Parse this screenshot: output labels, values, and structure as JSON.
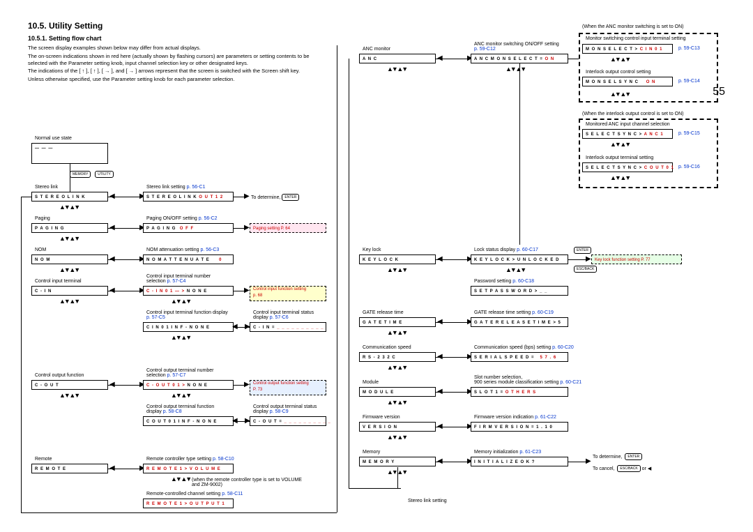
{
  "title": "10.5. Utility Setting",
  "subtitle": "10.5.1. Setting flow chart",
  "para1": "The screen display examples shown below may differ from actual displays.",
  "para2": "The on-screen indications shown in red here (actually shown by flashing cursors) are parameters or setting contents to be selected with the Parameter setting knob, input channel selection key or other designated keys.",
  "para3": "The indications of the [ ↑ ], [ ↑ ], [ → ], and [ → ] arrows represent that the screen is switched with the Screen shift key.",
  "para4": "Unless otherwise specified, use the Parameter setting knob for each parameter selection.",
  "page_num": "55",
  "col1": {
    "normal_use": "Normal use state",
    "normal_box": "— — —",
    "memory_btn": "MEMORY",
    "utility_btn": "UTILITY",
    "stereo_label": "Stereo link",
    "stereo_box": "S T E R E O    L I N K",
    "paging_label": "Paging",
    "paging_box": "P A G I N G",
    "nom_label": "NOM",
    "nom_box": "N O M",
    "cin_label": "Control input terminal",
    "cin_box": "C - I N",
    "cout_label": "Control output function",
    "cout_box": "C - O U T",
    "remote_label": "Remote",
    "remote_box": "R E M O T E"
  },
  "col2": {
    "stereo_set_label": "Stereo link setting",
    "stereo_set_ref": "p. 56-C1",
    "stereo_set_box_a": "S T E R E O    L I N K",
    "stereo_set_box_b": "O U T 1    2",
    "to_determine": "To determine,",
    "enter_btn": "ENTER",
    "paging_on_label": "Paging ON/OFF setting",
    "paging_on_ref": "p. 56-C2",
    "paging_on_box_a": "P A G I N G",
    "paging_on_box_b": "O F F",
    "paging_setting": "Paging setting",
    "paging_setting_ref": "P. 64",
    "nom_att_label": "NOM attenuation setting",
    "nom_att_ref": "p. 56-C3",
    "nom_att_box_a": "N O M    A T T E N U A T E",
    "nom_att_box_b": "0",
    "cin_num_label": "Control input terminal number selection",
    "cin_num_ref": "p. 57-C4",
    "cin_num_box_a": "C - I N 0 1 — >",
    "cin_num_box_b": "N O N E",
    "cin_func_set": "Control input function setting",
    "cin_func_ref": "p. 68",
    "cin_func_label": "Control input terminal function display",
    "cin_func_ref2": "p. 57-C5",
    "cin_func_box": "C I N 0 1 I N F -    N O N E",
    "cin_stat_label": "Control input terminal status display",
    "cin_stat_ref": "p. 57-C6",
    "cin_stat_box": "C - I N =",
    "cout_num_label": "Control output terminal number selection",
    "cout_num_ref": "p. 57-C7",
    "cout_num_box_a": "C - O U T 0 1 >",
    "cout_num_box_b": "N O N E",
    "cout_func_set": "Control output function setting",
    "cout_func_ref": "P. 73",
    "cout_func_label": "Control output terminal function display",
    "cout_func_ref2": "p. 58-C8",
    "cout_func_box": "C O U T 0 1 I N F - N O N E",
    "cout_stat_label": "Control output terminal status display",
    "cout_stat_ref": "p. 58-C9",
    "cout_stat_box": "C - O U T =",
    "remote_type_label": "Remote controller type setting",
    "remote_type_ref": "p. 58-C10",
    "remote_type_box_a": "R E M O T E 1 >",
    "remote_type_box_b": "V O L U M E",
    "remote_note": "(when the remote controller type is set to VOLUME and ZM-9002)",
    "remote_ch_label": "Remote-controlled channel setting",
    "remote_ch_ref": "p. 58-C11",
    "remote_ch_box_a": "R E M O T E 1 >",
    "remote_ch_box_b": "O U T P U T 1"
  },
  "col3": {
    "anc_label": "ANC monitor",
    "anc_box": "A N C",
    "keylock_label": "Key lock",
    "keylock_box": "K E Y L O C K",
    "gate_label": "GATE release time",
    "gate_box": "G A T E    T I M E",
    "rs_label": "Communication speed",
    "rs_box": "R S - 2 3 2 C",
    "module_label": "Module",
    "module_box": "M O D U L E",
    "version_label": "Firmware version",
    "version_box": "V E R S I O N",
    "memory_label": "Memory",
    "memory_box": "M E M O R Y",
    "stereo_link_bottom": "Stereo link setting"
  },
  "col4": {
    "anc_sw_label": "ANC monitor switching ON/OFF setting",
    "anc_sw_ref": "p. 59-C12",
    "anc_sw_box_a": "A N C    M O N    S E L E C T =",
    "anc_sw_box_b": "O N",
    "lock_stat_label": "Lock status display",
    "lock_stat_ref": "p. 60-C17",
    "lock_stat_box": "K E Y L O C K > U N L O C K E D",
    "keylock_fn": "Key lock function setting",
    "keylock_fn_ref": "P. 77",
    "pass_label": "Password setting",
    "pass_ref": "p. 60-C18",
    "pass_box": "S E T P A S S W O R D     > _ _",
    "gate_set_label": "GATE release time setting",
    "gate_set_ref": "p. 60-C19",
    "gate_set_box": "G A T E    R E L E A S E T I M E > 5",
    "speed_label": "Communication speed (bps) setting",
    "speed_ref": "p. 60-C20",
    "speed_box_a": "S E R I A L    S P E E D =",
    "speed_box_b": "5 7 . 6",
    "slot_label": "Slot number selection,",
    "slot_label2": "900 series module classification setting",
    "slot_ref": "p. 60-C21",
    "slot_box_a": "S L O T 1 =",
    "slot_box_b": "O T H E R S",
    "firm_label": "Firmware version indication",
    "firm_ref": "p. 61-C22",
    "firm_box": "F I R M    V E R S I O N = 1 . 1 0",
    "mem_label": "Memory initialization",
    "mem_ref": "p. 61-C23",
    "mem_box": "I N I T I A L I Z E    O K ?",
    "to_determine2": "To determine,",
    "to_cancel": "To cancel,",
    "enter_btn2": "ENTER",
    "esc_btn": "ESC/BACK",
    "or_txt": "or"
  },
  "col5": {
    "anc_on_note": "(When the ANC monitor switching is set to ON)",
    "mon_sw_label": "Monitor switching control input terminal setting",
    "mon_sw_box_a": "M O N    S E L E C T >",
    "mon_sw_box_b": "C I N 0 1",
    "mon_sw_ref": "p. 59-C13",
    "interlock_label": "Interlock output control setting",
    "interlock_box_a": "M O N    S E L    S Y N C",
    "interlock_box_b": "O N",
    "interlock_ref": "p. 59-C14",
    "interlock_on_note": "(When the interlock output control is set to ON)",
    "anc_ch_label": "Monitored ANC input channel selection",
    "anc_ch_box_a": "S E L E C T    S Y N C >",
    "anc_ch_box_b": "A N C 1",
    "anc_ch_ref": "p. 59-C15",
    "out_term_label": "Interlock output terminal setting",
    "out_term_box_a": "S E L E C T    S Y N C >",
    "out_term_box_b": "C O U T 0 1",
    "out_term_ref": "p. 59-C16",
    "enter_btn3": "ENTER",
    "esc_btn3": "ESC/BACK"
  }
}
